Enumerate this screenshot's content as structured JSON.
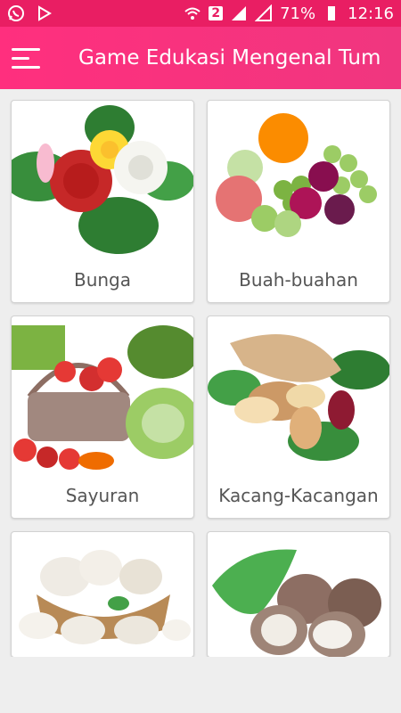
{
  "status": {
    "battery": "71%",
    "time": "12:16",
    "sim": "2"
  },
  "app": {
    "title": "Game Edukasi Mengenal Tum..."
  },
  "categories": [
    {
      "label": "Bunga",
      "icon": "flower-icon"
    },
    {
      "label": "Buah-buahan",
      "icon": "fruit-icon"
    },
    {
      "label": "Sayuran",
      "icon": "vegetable-basket-icon"
    },
    {
      "label": "Kacang-Kacangan",
      "icon": "nuts-icon"
    },
    {
      "label": "",
      "icon": "mushroom-basket-icon"
    },
    {
      "label": "",
      "icon": "taro-icon"
    }
  ],
  "colors": {
    "primary": "#ff2f7e",
    "statusbar": "#e91e63"
  }
}
